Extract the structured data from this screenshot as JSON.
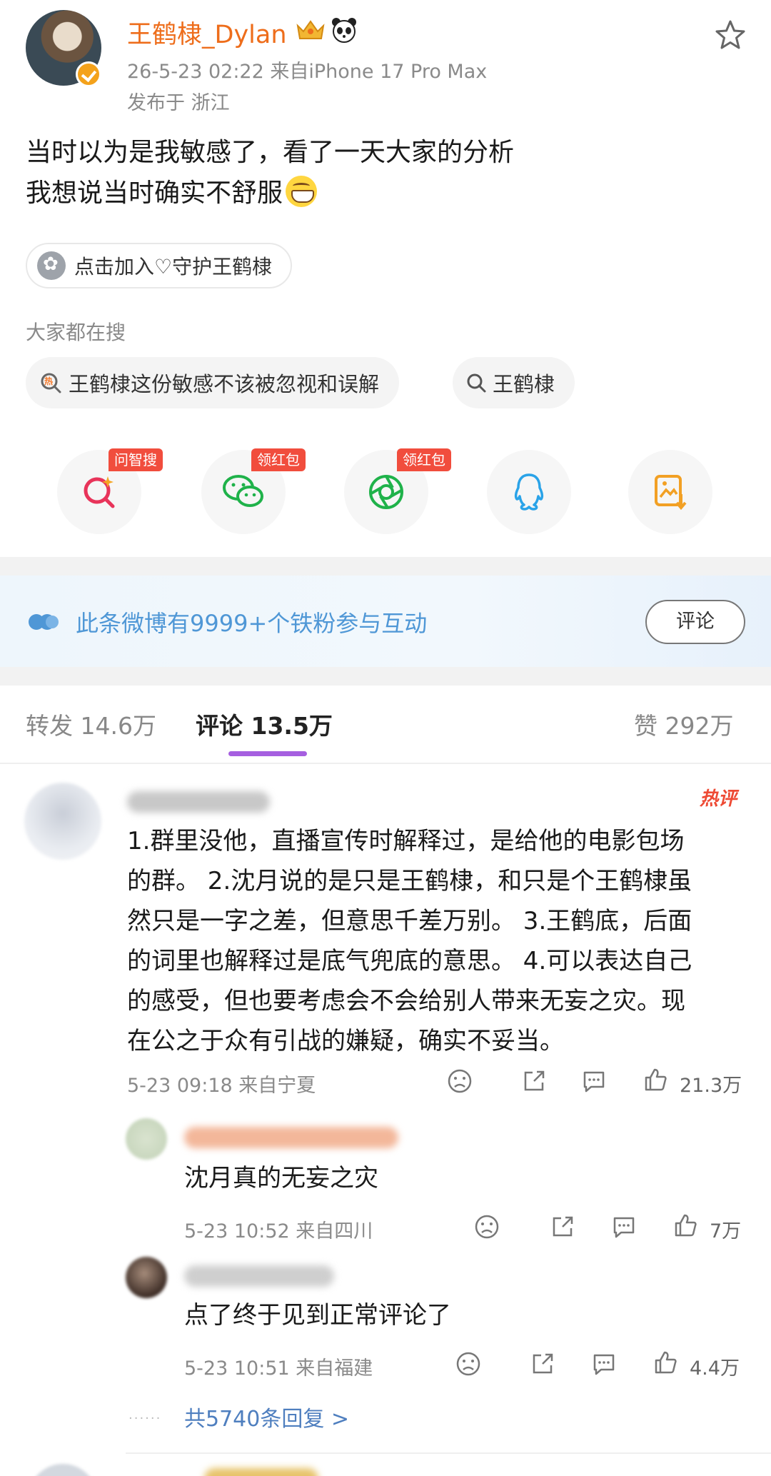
{
  "post": {
    "author": "王鹤棣_Dylan",
    "time_device": "26-5-23 02:22  来自iPhone 17 Pro Max",
    "location": "发布于 浙江",
    "text_line1": "当时以为是我敏感了，看了一天大家的分析",
    "text_line2": "我想说当时确实不舒服",
    "guard_label": "点击加入♡守护王鹤棣",
    "hot_search_title": "大家都在搜",
    "hot_search_icon": "热",
    "search_chips": [
      "王鹤棣这份敏感不该被忽视和误解",
      "王鹤棣"
    ]
  },
  "share": {
    "badges": [
      "问智搜",
      "领红包",
      "领红包"
    ],
    "icons": [
      "ai-search-icon",
      "wechat-icon",
      "moments-icon",
      "qq-icon",
      "save-image-icon"
    ]
  },
  "fans_banner": {
    "text": "此条微博有9999+个铁粉参与互动",
    "button": "评论"
  },
  "tabs": {
    "repost": "转发 14.6万",
    "comments": "评论 13.5万",
    "likes": "赞 292万"
  },
  "comments": [
    {
      "badge": "热评",
      "text": [
        "1.群里没他，直播宣传时解释过，是给他的电影包场",
        "的群。 2.沈月说的是只是王鹤棣，和只是个王鹤棣虽",
        "然只是一字之差，但意思千差万别。 3.王鹤底，后面",
        "的词里也解释过是底气兜底的意思。 4.可以表达自己",
        "的感受，但也要考虑会不会给别人带来无妄之灾。现",
        "在公之于众有引战的嫌疑，确实不妥当。"
      ],
      "meta": "5-23 09:18  来自宁夏",
      "likes": "21.3万",
      "replies": [
        {
          "text": "沈月真的无妄之灾",
          "meta": "5-23 10:52  来自四川",
          "likes": "7万"
        },
        {
          "text": "点了终于见到正常评论了",
          "meta": "5-23 10:51  来自福建",
          "likes": "4.4万"
        }
      ],
      "more_replies": "共5740条回复 >"
    }
  ],
  "colors": {
    "username": "#ee6d1b",
    "link_blue": "#4f97d6",
    "tab_underline": "#a65fe0",
    "badge_red": "#f14d3d"
  }
}
